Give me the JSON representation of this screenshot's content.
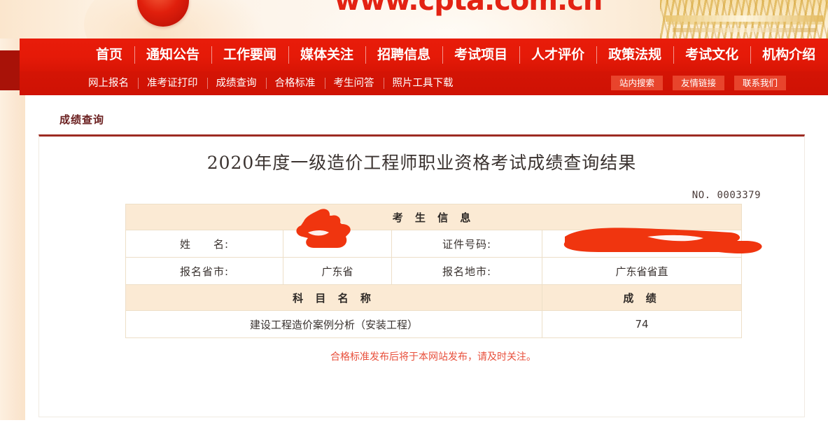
{
  "banner": {
    "url_text": "www.cpta.com.cn",
    "logo_icon": "circle-seal-icon",
    "decoration_icon": "gold-pattern-icon"
  },
  "nav": {
    "main_items": [
      {
        "label": "首页"
      },
      {
        "label": "通知公告"
      },
      {
        "label": "工作要闻"
      },
      {
        "label": "媒体关注"
      },
      {
        "label": "招聘信息"
      },
      {
        "label": "考试项目"
      },
      {
        "label": "人才评价"
      },
      {
        "label": "政策法规"
      },
      {
        "label": "考试文化"
      },
      {
        "label": "机构介绍"
      }
    ],
    "sub_items": [
      {
        "label": "网上报名"
      },
      {
        "label": "准考证打印"
      },
      {
        "label": "成绩查询"
      },
      {
        "label": "合格标准"
      },
      {
        "label": "考生问答"
      },
      {
        "label": "照片工具下载"
      }
    ],
    "sub_buttons": [
      {
        "label": "站内搜索"
      },
      {
        "label": "友情链接"
      },
      {
        "label": "联系我们"
      }
    ]
  },
  "breadcrumb": {
    "label": "成绩查询"
  },
  "content": {
    "title": "2020年度一级造价工程师职业资格考试成绩查询结果",
    "serial": "NO. 0003379",
    "candidate_info_header": "考 生 信 息",
    "rows": [
      {
        "label_1": "姓　　名:",
        "value_1": "",
        "label_2": "证件号码:",
        "value_2": ""
      },
      {
        "label_1": "报名省市:",
        "value_1": "广东省",
        "label_2": "报名地市:",
        "value_2": "广东省省直"
      }
    ],
    "score_header_subject": "科 目 名 称",
    "score_header_score": "成 绩",
    "score_rows": [
      {
        "subject": "建设工程造价案例分析（安装工程）",
        "score": "74"
      }
    ],
    "notice": "合格标准发布后将于本网站发布，请及时关注。"
  },
  "colors": {
    "nav_red": "#e51a08",
    "nav_sub_red": "#d41405",
    "nav_shadow_red": "#a81208",
    "table_header_bg": "#fbead4",
    "table_border": "#eddfc8",
    "notice_red": "#e8503c",
    "redaction_red": "#f0350f",
    "breadcrumb_color": "#6b2020",
    "card_top_border": "#9d2b22"
  }
}
